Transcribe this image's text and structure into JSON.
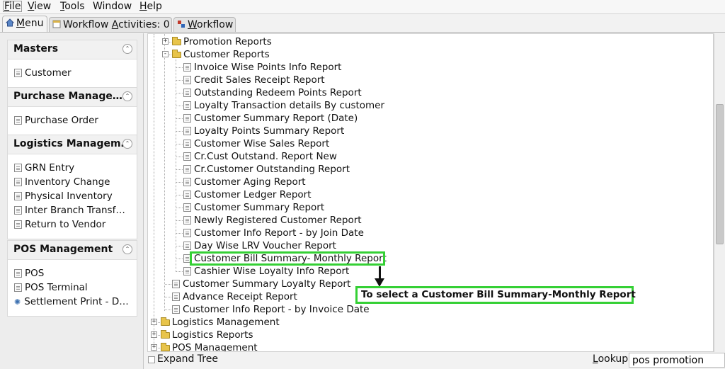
{
  "menubar": [
    {
      "label": "File",
      "access": "F",
      "rest": "ile"
    },
    {
      "label": "View",
      "access": "V",
      "rest": "iew"
    },
    {
      "label": "Tools",
      "access": "T",
      "rest": "ools"
    },
    {
      "label": "Window",
      "access": "",
      "rest": "Window"
    },
    {
      "label": "Help",
      "access": "H",
      "rest": "elp"
    }
  ],
  "tabs": [
    {
      "label": "Menu",
      "access": "M",
      "rest": "enu",
      "icon": "home-icon"
    },
    {
      "label": "Workflow Activities: 0",
      "pre": "Workflow ",
      "access": "A",
      "rest": "ctivities: 0",
      "icon": "calendar-icon"
    },
    {
      "label": "Workflow",
      "access": "W",
      "rest": "orkflow",
      "icon": "workflow-icon"
    }
  ],
  "sidebar": {
    "sections": [
      {
        "title": "Masters",
        "items": [
          {
            "label": "Customer",
            "icon": "document-icon"
          }
        ]
      },
      {
        "title": "Purchase Manage…",
        "items": [
          {
            "label": "Purchase Order",
            "icon": "document-icon"
          }
        ]
      },
      {
        "title": "Logistics Managem…",
        "items": [
          {
            "label": "GRN Entry",
            "icon": "document-icon"
          },
          {
            "label": "Inventory Change",
            "icon": "document-icon"
          },
          {
            "label": "Physical Inventory",
            "icon": "document-icon"
          },
          {
            "label": "Inter Branch Transf…",
            "icon": "document-icon"
          },
          {
            "label": "Return to Vendor",
            "icon": "document-icon"
          }
        ]
      },
      {
        "title": "POS Management",
        "items": [
          {
            "label": "POS",
            "icon": "document-icon"
          },
          {
            "label": "POS Terminal",
            "icon": "document-icon"
          },
          {
            "label": "Settlement Print - D…",
            "icon": "gear-icon"
          }
        ]
      }
    ]
  },
  "tree": [
    {
      "label": "Promotion Reports",
      "type": "folder",
      "level": 2,
      "expander": "+"
    },
    {
      "label": "Customer Reports",
      "type": "folder",
      "level": 2,
      "expander": "-"
    },
    {
      "label": "Invoice Wise Points Info Report",
      "type": "doc",
      "level": 3
    },
    {
      "label": "Credit Sales Receipt Report",
      "type": "doc",
      "level": 3
    },
    {
      "label": "Outstanding Redeem Points Report",
      "type": "doc",
      "level": 3
    },
    {
      "label": "Loyalty Transaction details By customer",
      "type": "doc",
      "level": 3
    },
    {
      "label": "Customer Summary Report (Date)",
      "type": "doc",
      "level": 3
    },
    {
      "label": "Loyalty Points Summary Report",
      "type": "doc",
      "level": 3
    },
    {
      "label": "Customer Wise Sales Report",
      "type": "doc",
      "level": 3
    },
    {
      "label": "Cr.Cust Outstand. Report New",
      "type": "doc",
      "level": 3
    },
    {
      "label": "Cr.Customer Outstanding Report",
      "type": "doc",
      "level": 3
    },
    {
      "label": "Customer Aging Report",
      "type": "doc",
      "level": 3
    },
    {
      "label": "Customer Ledger Report",
      "type": "doc",
      "level": 3
    },
    {
      "label": "Customer Summary Report",
      "type": "doc",
      "level": 3
    },
    {
      "label": "Newly Registered Customer Report",
      "type": "doc",
      "level": 3
    },
    {
      "label": "Customer Info Report - by Join Date",
      "type": "doc",
      "level": 3
    },
    {
      "label": "Day Wise LRV Voucher Report",
      "type": "doc",
      "level": 3
    },
    {
      "label": "Customer Bill Summary- Monthly Report",
      "type": "doc",
      "level": 3,
      "highlighted": true
    },
    {
      "label": "Cashier Wise Loyalty Info Report",
      "type": "doc",
      "level": 3
    },
    {
      "label": "Customer Summary Loyalty Report",
      "type": "doc",
      "level": 2
    },
    {
      "label": "Advance Receipt Report",
      "type": "doc",
      "level": 2
    },
    {
      "label": "Customer Info Report - by Invoice Date",
      "type": "doc",
      "level": 2
    },
    {
      "label": "Logistics Management",
      "type": "folder",
      "level": 1,
      "expander": "+"
    },
    {
      "label": "Logistics Reports",
      "type": "folder",
      "level": 1,
      "expander": "+"
    },
    {
      "label": "POS Management",
      "type": "folder",
      "level": 1,
      "expander": "+"
    }
  ],
  "annotation": {
    "text": "To select a Customer Bill Summary-Monthly Report",
    "color": "#35d035"
  },
  "bottom": {
    "expand_tree_label": "Expand Tree",
    "lookup_label": "Lookup",
    "lookup_value": "pos promotion"
  }
}
